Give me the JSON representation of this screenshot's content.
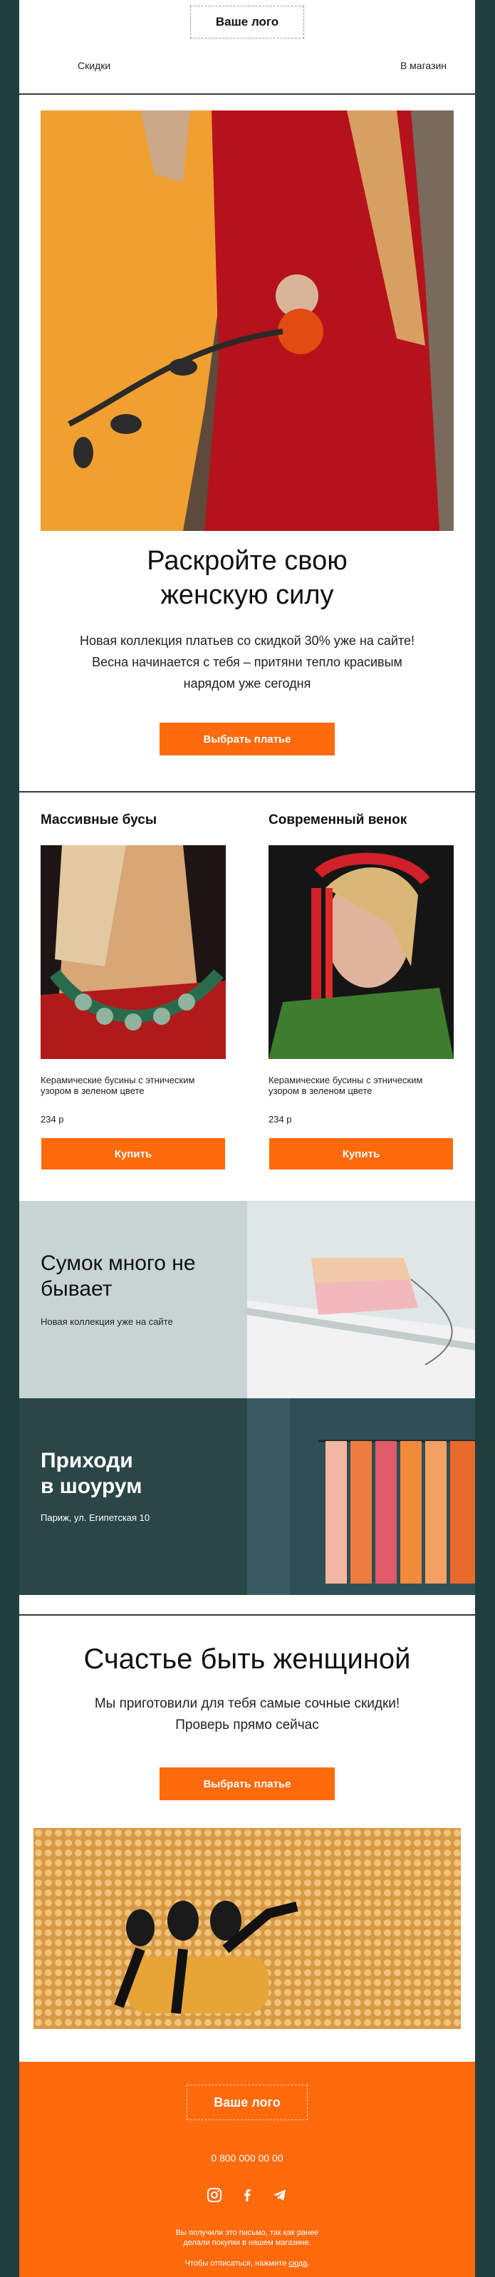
{
  "header": {
    "logo": "Ваше лого",
    "nav_left": "Скидки",
    "nav_right": "В магазин"
  },
  "hero": {
    "title_line1": "Раскройте свою",
    "title_line2": "женскую силу",
    "text_line1": "Новая коллекция платьев со скидкой 30% уже на сайте!",
    "text_line2": "Весна начинается с тебя – притяни тепло красивым",
    "text_line3": "нарядом уже сегодня",
    "button": "Выбрать платье"
  },
  "products": [
    {
      "title": "Массивные бусы",
      "desc": "Керамические бусины с этническим узором в зеленом цвете",
      "price": "234 р",
      "button": "Купить"
    },
    {
      "title": "Современный венок",
      "desc": "Керамические бусины с этническим узором в зеленом цвете",
      "price": "234 р",
      "button": "Купить"
    }
  ],
  "bags": {
    "title_line1": "Сумок много не",
    "title_line2": "бывает",
    "subtitle": "Новая коллекция уже на сайте"
  },
  "showroom": {
    "title_line1": "Приходи",
    "title_line2": "в шоурум",
    "address": "Париж, ул. Египетская 10"
  },
  "promo": {
    "title": "Счастье быть женщиной",
    "text_line1": "Мы приготовили для тебя самые сочные скидки!",
    "text_line2": "Проверь прямо сейчас",
    "button": "Выбрать платье"
  },
  "footer": {
    "logo": "Ваше лого",
    "phone": "0 800 000 00 00",
    "note_line1": "Вы получили это письмо, так как ранее",
    "note_line2": "делали покупки в нашем магазине.",
    "unsub_prefix": "Чтобы отписаться, нажмите ",
    "unsub_link": "сюда",
    "unsub_suffix": "."
  },
  "colors": {
    "accent": "#ff6a0d",
    "dark_bg": "#213e3e",
    "bags_bg": "#c8d4d4",
    "showroom_bg": "#2a4646"
  },
  "icons": [
    "instagram-icon",
    "facebook-icon",
    "telegram-icon"
  ]
}
